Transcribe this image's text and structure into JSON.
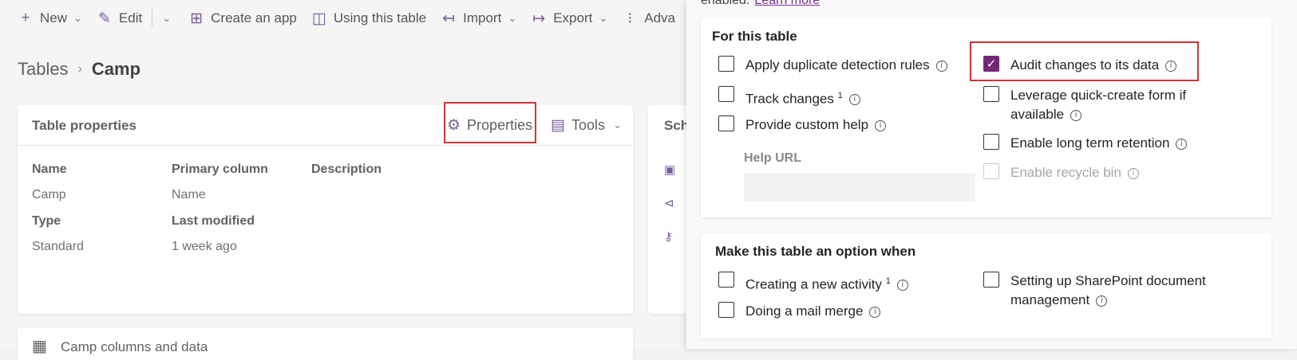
{
  "toolbar": {
    "new": "New",
    "edit": "Edit",
    "create_app": "Create an app",
    "using_table": "Using this table",
    "import": "Import",
    "export": "Export",
    "advanced": "Adva"
  },
  "breadcrumb": {
    "root": "Tables",
    "current": "Camp"
  },
  "table_properties": {
    "title": "Table properties",
    "properties_button": "Properties",
    "tools_button": "Tools",
    "fields": [
      {
        "label": "Name",
        "value": "Camp"
      },
      {
        "label": "Primary column",
        "value": "Name"
      },
      {
        "label": "Description",
        "value": ""
      },
      {
        "label": "Type",
        "value": "Standard"
      },
      {
        "label": "Last modified",
        "value": "1 week ago"
      }
    ]
  },
  "schema_card": {
    "title": "Sch"
  },
  "columns_card": {
    "title": "Camp columns and data"
  },
  "panel": {
    "intro_text": "enabled.",
    "learn_more": "Learn more",
    "for_this_table": {
      "title": "For this table",
      "options": [
        {
          "label": "Apply duplicate detection rules",
          "checked": false
        },
        {
          "label": "Track changes",
          "sup": "1",
          "checked": false
        },
        {
          "label": "Provide custom help",
          "checked": false
        },
        {
          "label": "Audit changes to its data",
          "checked": true
        },
        {
          "label": "Leverage quick-create form if available",
          "checked": false
        },
        {
          "label": "Enable long term retention",
          "checked": false
        },
        {
          "label": "Enable recycle bin",
          "checked": false,
          "disabled": true
        }
      ],
      "help_url_label": "Help URL",
      "help_url_value": ""
    },
    "option_when": {
      "title": "Make this table an option when",
      "options": [
        {
          "label": "Creating a new activity",
          "sup": "1",
          "checked": false
        },
        {
          "label": "Doing a mail merge",
          "checked": false
        },
        {
          "label": "Setting up SharePoint document management",
          "checked": false
        }
      ]
    }
  },
  "colors": {
    "accent": "#742774",
    "highlight": "#d13438"
  },
  "icons": {
    "new": "plus-icon",
    "edit": "pencil-icon",
    "create_app": "app-grid-icon",
    "using_table": "table-usage-icon",
    "import": "import-arrow-icon",
    "export": "export-arrow-icon",
    "advanced": "sliders-icon",
    "properties": "gear-icon",
    "tools": "toolbox-icon",
    "info": "info-icon"
  }
}
